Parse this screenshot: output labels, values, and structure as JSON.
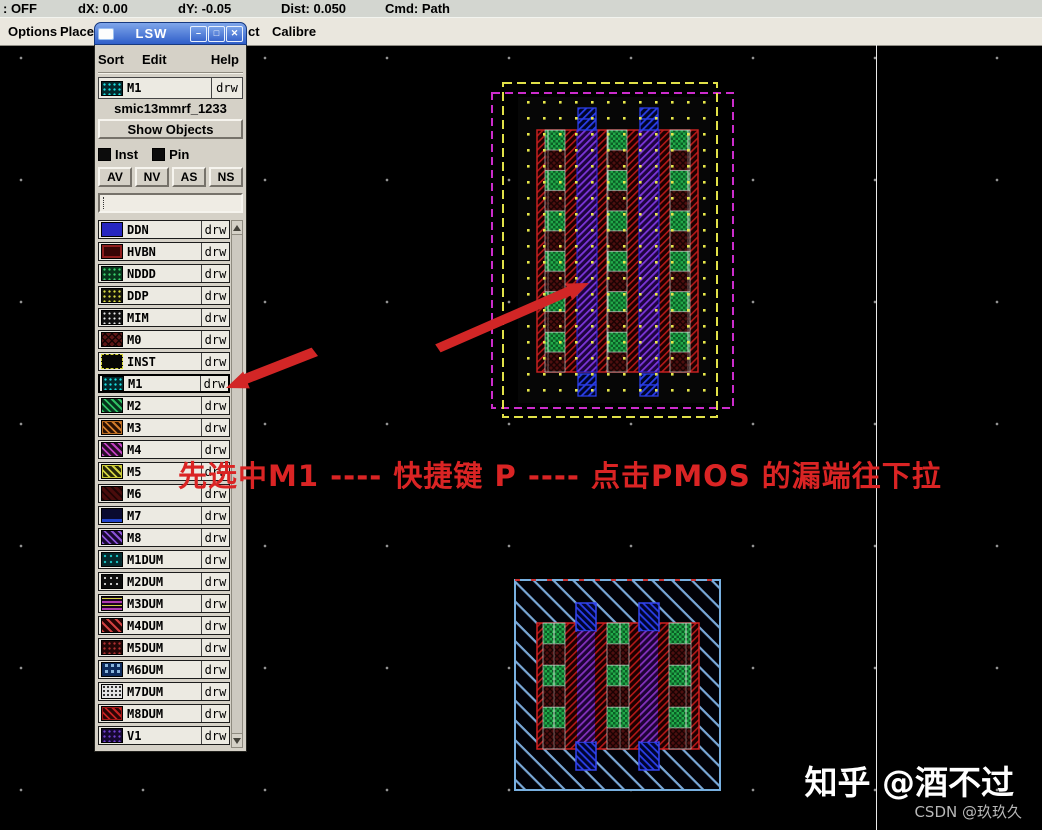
{
  "status_bar": {
    "items": [
      ": OFF",
      "dX: 0.00",
      "dY: -0.05",
      "Dist: 0.050",
      "Cmd: Path"
    ]
  },
  "menu_bar": {
    "items": [
      "Options",
      "Place",
      "ct",
      "Calibre"
    ]
  },
  "lsw": {
    "title": "LSW",
    "window_icons": [
      {
        "name": "minimize-icon",
        "glyph": "–"
      },
      {
        "name": "maximize-icon",
        "glyph": "□"
      },
      {
        "name": "close-icon",
        "glyph": "✕"
      }
    ],
    "menu": [
      "Sort",
      "Edit",
      "Help"
    ],
    "current_layer": {
      "name": "M1",
      "purpose": "drw"
    },
    "library": "smic13mmrf_1233",
    "show_objects_label": "Show Objects",
    "toggles": [
      {
        "label": "Inst"
      },
      {
        "label": "Pin"
      }
    ],
    "filter_buttons": [
      "AV",
      "NV",
      "AS",
      "NS"
    ],
    "filter_value": "",
    "layers": [
      {
        "name": "DDN",
        "purpose": "drw",
        "selected": false
      },
      {
        "name": "HVBN",
        "purpose": "drw",
        "selected": false
      },
      {
        "name": "NDDD",
        "purpose": "drw",
        "selected": false
      },
      {
        "name": "DDP",
        "purpose": "drw",
        "selected": false
      },
      {
        "name": "MIM",
        "purpose": "drw",
        "selected": false
      },
      {
        "name": "M0",
        "purpose": "drw",
        "selected": false
      },
      {
        "name": "INST",
        "purpose": "drw",
        "selected": false
      },
      {
        "name": "M1",
        "purpose": "drw",
        "selected": true
      },
      {
        "name": "M2",
        "purpose": "drw",
        "selected": false
      },
      {
        "name": "M3",
        "purpose": "drw",
        "selected": false
      },
      {
        "name": "M4",
        "purpose": "drw",
        "selected": false
      },
      {
        "name": "M5",
        "purpose": "drw",
        "selected": false
      },
      {
        "name": "M6",
        "purpose": "drw",
        "selected": false
      },
      {
        "name": "M7",
        "purpose": "drw",
        "selected": false
      },
      {
        "name": "M8",
        "purpose": "drw",
        "selected": false
      },
      {
        "name": "M1DUM",
        "purpose": "drw",
        "selected": false
      },
      {
        "name": "M2DUM",
        "purpose": "drw",
        "selected": false
      },
      {
        "name": "M3DUM",
        "purpose": "drw",
        "selected": false
      },
      {
        "name": "M4DUM",
        "purpose": "drw",
        "selected": false
      },
      {
        "name": "M5DUM",
        "purpose": "drw",
        "selected": false
      },
      {
        "name": "M6DUM",
        "purpose": "drw",
        "selected": false
      },
      {
        "name": "M7DUM",
        "purpose": "drw",
        "selected": false
      },
      {
        "name": "M8DUM",
        "purpose": "drw",
        "selected": false
      },
      {
        "name": "V1",
        "purpose": "drw",
        "selected": false
      }
    ]
  },
  "annotation": {
    "text": "先选中M1 ----  快捷键 P ---- 点击PMOS 的漏端往下拉",
    "color": "#da2424"
  },
  "watermark": {
    "primary": "知乎 @酒不过",
    "secondary": "CSDN @玖玖久"
  },
  "colors": {
    "canvas": "#000000",
    "titlebar_blue": "#3a66cc",
    "annotation_red": "#da2424",
    "grid_dot": "#9a9a9a"
  }
}
